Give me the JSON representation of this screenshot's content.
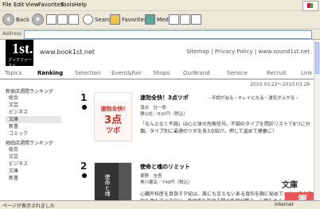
{
  "menu": {
    "file": "File",
    "edit": "Edit",
    "view": "View",
    "favorites": "Favorites",
    "tools": "Tools",
    "help": "Help"
  },
  "toolbar": {
    "back": "Back",
    "search": "Search",
    "favorites": "Favorites",
    "media": "Media"
  },
  "address": {
    "label": "Address"
  },
  "site": {
    "logo_text": "1st.",
    "logo_sub": "ブックファースト",
    "url": "www.book1st.net",
    "top_links": "Sitemap | Privacy Policy | www.sound1st.net",
    "nav": [
      "Topics",
      "Ranking",
      "Selection",
      "Event&Fair",
      "Shops",
      "OurBrand",
      "Service",
      "Recruit",
      "Link"
    ],
    "dates": "2010.03.22～2010.03.28"
  },
  "sidebar": {
    "group1_title": "新宿店週間ランキング",
    "group1_items": [
      "総合",
      "文芸",
      "ビジネス",
      "文庫",
      "新書",
      "コミック"
    ],
    "group2_title": "梅田店週間ランキング",
    "group2_items": [
      "総合",
      "文芸",
      "ビジネス",
      "文庫",
      "新書"
    ]
  },
  "rankings": [
    {
      "rank": "1",
      "title": "速効全快！3点ツボ",
      "subtitle": "- 不調が治る・キレイになる・運気が上がる -",
      "author": "滝合　壮一郎",
      "publisher_price": "静山社／610円（税込）",
      "description": "「なんとなく不調」は心と体の危険信号。不調のタイプを問診リストで8つに分類。タイプ別に最適のツボを各3点紹介。押して温めて健康に！",
      "cover_text": "速効全快!3点ツボ"
    },
    {
      "rank": "2",
      "title": "使命と魂のリミット",
      "author": "東野　圭吾",
      "publisher_price": "角川書店／740円（税込）",
      "description": "心臓外科医を目指す夕紀は、誰にも言えないある目的を胸に秘めていた。その目的を果たすべき日に、手術室を前代未聞の危機が襲う。心臓をめぐるサスペ",
      "cover_text": "使命と魂のリミット 東野圭吾"
    }
  ],
  "banner": {
    "line1": "文庫",
    "line2": "第"
  },
  "status": {
    "left": "ページが表示されました",
    "right": "Internet"
  }
}
